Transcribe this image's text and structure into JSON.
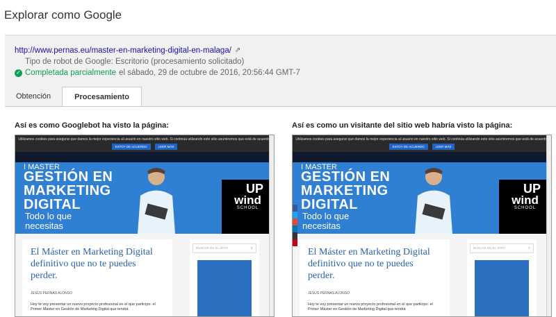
{
  "title": "Explorar como Google",
  "fetch": {
    "url": "http://www.pernas.eu/master-en-marketing-digital-en-malaga/",
    "bot_type": "Tipo de robot de Google: Escritorio (procesamiento solicitado)",
    "status_label": "Completada parcialmente",
    "status_detail": " el sábado, 29 de octubre de 2016, 20:56:44 GMT-7"
  },
  "tabs": [
    {
      "label": "Obtención"
    },
    {
      "label": "Procesamiento"
    }
  ],
  "captions": {
    "googlebot": "Así es como Googlebot ha visto la página:",
    "visitor": "Así es como un visitante del sitio web habría visto la página:"
  },
  "preview": {
    "cookie_text": "Utilizamos cookies para asegurar que damos la mejor experiencia al usuario en nuestro sitio web. Si continúa utilizando este sitio asumiremos que está de acuerdo.",
    "accept_btn": "ESTOY DE ACUERDO",
    "read_more_btn": "LEER MÁS",
    "hero_line1": "I MASTER",
    "hero_line2": "GESTIÓN EN MARKETING DIGITAL",
    "hero_line3": "Todo lo que necesitas",
    "logo_up": "UP",
    "logo_wind": "wind",
    "logo_school": "SCHOOL",
    "article_title": "El Máster en Marketing Digital definitivo que no te puedes perder.",
    "author": "JESÚS PERNAS ALONSO",
    "paragraph": "Hoy te voy presentar un nuevo proyecto profesional en el que participo: el Primer Máster en Gestión de Marketing Digital que tendrá",
    "search_placeholder": "BUSCAR EN EL SITIO"
  },
  "colors": {
    "link": "#1a0dab",
    "success": "#0f9d58",
    "hero_blue": "#2f7fd3",
    "title_blue": "#2a64b0"
  }
}
